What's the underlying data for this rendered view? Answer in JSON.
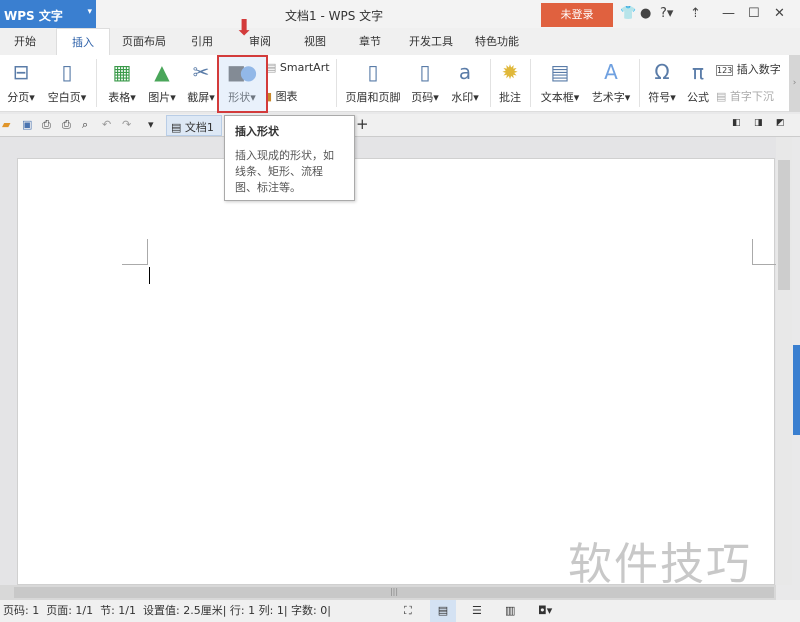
{
  "app": {
    "logo": "WPS 文字",
    "title": "文档1 - WPS 文字",
    "login": "未登录"
  },
  "tabs": [
    "开始",
    "插入",
    "页面布局",
    "引用",
    "审阅",
    "视图",
    "章节",
    "开发工具",
    "特色功能"
  ],
  "ribbon": {
    "page_break": "分页",
    "blank_page": "空白页",
    "table": "表格",
    "picture": "图片",
    "screenshot": "截屏",
    "shape": "形状",
    "smartart": "SmartArt",
    "chart": "图表",
    "header_footer": "页眉和页脚",
    "page_number": "页码",
    "watermark": "水印",
    "comment": "批注",
    "textbox": "文本框",
    "wordart": "艺术字",
    "symbol": "符号",
    "formula": "公式",
    "insert_number": "插入数字",
    "drop_cap": "首字下沉"
  },
  "doc_tab": "文档1",
  "tooltip": {
    "title": "插入形状",
    "desc": "插入现成的形状，如线条、矩形、流程图、标注等。"
  },
  "status": {
    "page": "页码: 1",
    "pages": "页面: 1/1",
    "section": "节: 1/1",
    "setting": "设置值: 2.5厘米",
    "row": "行: 1",
    "col": "列: 1",
    "words": "字数: 0"
  },
  "watermark": "软件技巧"
}
